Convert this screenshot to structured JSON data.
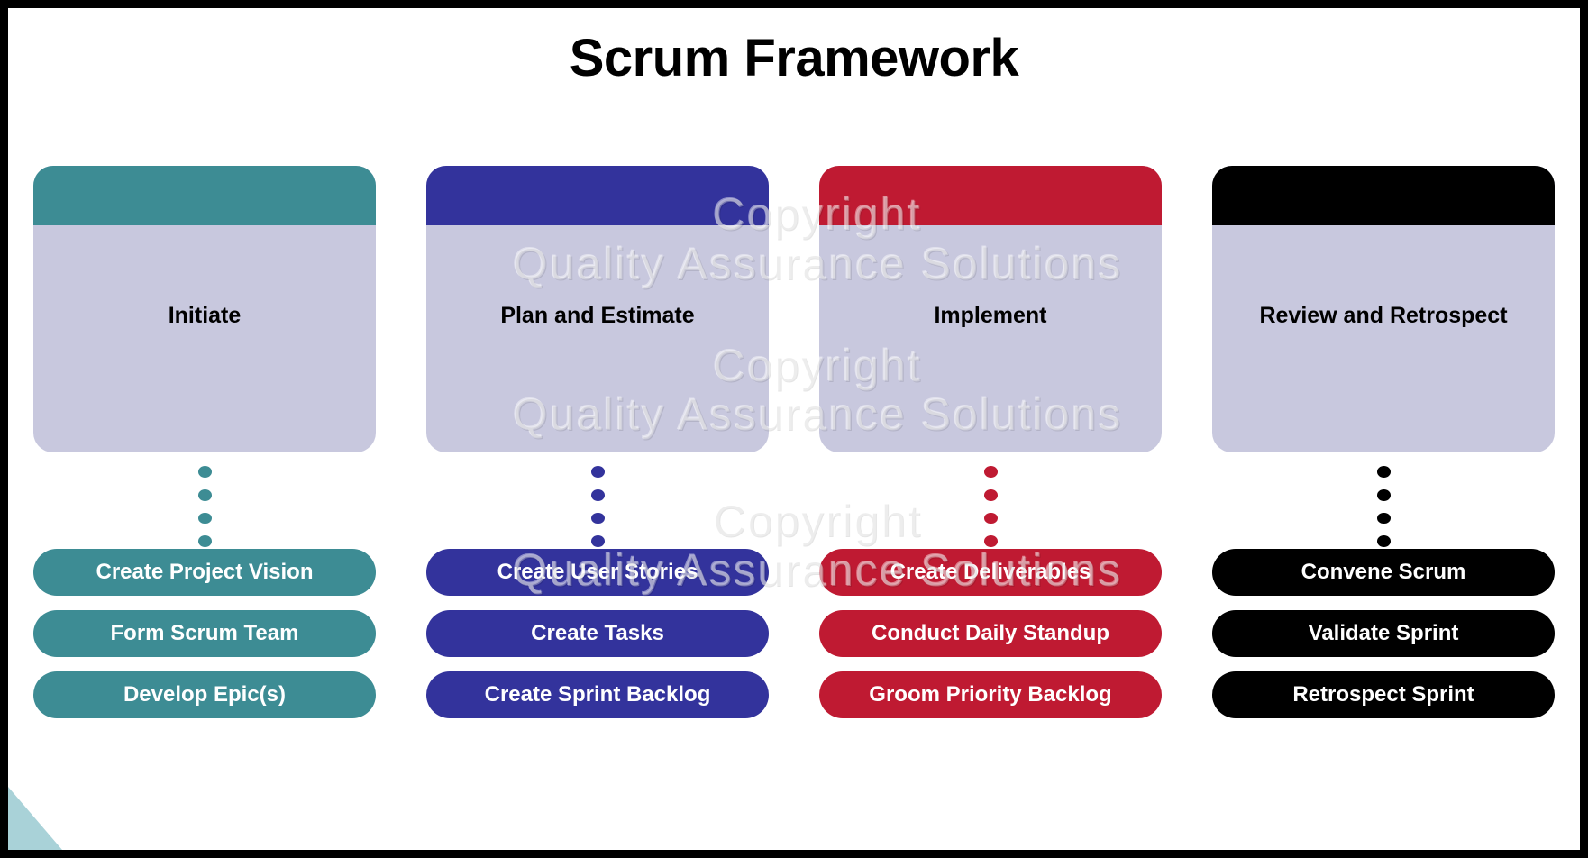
{
  "page": {
    "title": "Scrum Framework",
    "background": "#ffffff",
    "border_color": "#000000",
    "corner_accent_color": "#a9d2d8",
    "card_body_color": "#c8c8de"
  },
  "watermark": {
    "line1": "Copyright",
    "line2": "Quality Assurance Solutions"
  },
  "columns": [
    {
      "phase": "Initiate",
      "color": "#3d8c94",
      "dots": 4,
      "steps": [
        "Create Project Vision",
        "Form Scrum Team",
        "Develop Epic(s)"
      ]
    },
    {
      "phase": "Plan and Estimate",
      "color": "#33339c",
      "dots": 4,
      "steps": [
        "Create User Stories",
        "Create Tasks",
        "Create Sprint Backlog"
      ]
    },
    {
      "phase": "Implement",
      "color": "#bf1a32",
      "dots": 4,
      "steps": [
        "Create Deliverables",
        "Conduct Daily Standup",
        "Groom Priority Backlog"
      ]
    },
    {
      "phase": "Review and Retrospect",
      "color": "#000000",
      "dots": 4,
      "steps": [
        "Convene Scrum",
        "Validate Sprint",
        "Retrospect Sprint"
      ]
    }
  ]
}
